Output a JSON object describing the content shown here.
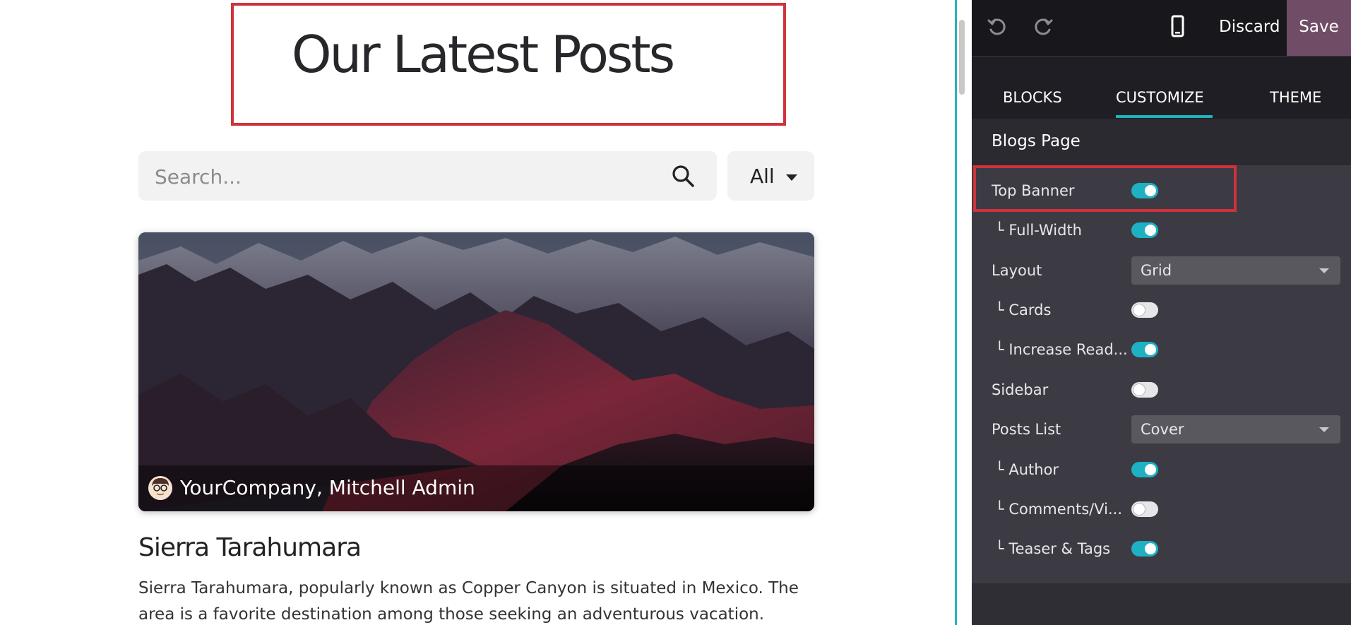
{
  "preview": {
    "title": "Our Latest Posts",
    "search": {
      "placeholder": "Search...",
      "icon": "search-icon"
    },
    "filter": {
      "label": "All",
      "icon": "caret-down-icon"
    },
    "post": {
      "authors": "YourCompany, Mitchell Admin",
      "title": "Sierra Tarahumara",
      "teaser_line1": "Sierra Tarahumara, popularly known as Copper Canyon is situated in Mexico. The",
      "teaser_line2": "area is a favorite destination among those seeking an adventurous vacation."
    }
  },
  "editor": {
    "toolbar": {
      "undo_icon": "undo-icon",
      "redo_icon": "redo-icon",
      "mobile_icon": "mobile-preview-icon",
      "discard": "Discard",
      "save": "Save"
    },
    "tabs": [
      {
        "label": "BLOCKS",
        "active": false
      },
      {
        "label": "CUSTOMIZE",
        "active": true
      },
      {
        "label": "THEME",
        "active": false
      }
    ],
    "section_title": "Blogs Page",
    "options": [
      {
        "label": "Top Banner",
        "sub": false,
        "type": "toggle",
        "on": true
      },
      {
        "label": "Full-Width",
        "sub": true,
        "type": "toggle",
        "on": true
      },
      {
        "label": "Layout",
        "sub": false,
        "type": "select",
        "value": "Grid"
      },
      {
        "label": "Cards",
        "sub": true,
        "type": "toggle",
        "on": false
      },
      {
        "label": "Increase Read...",
        "sub": true,
        "type": "toggle",
        "on": true
      },
      {
        "label": "Sidebar",
        "sub": false,
        "type": "toggle",
        "on": false
      },
      {
        "label": "Posts List",
        "sub": false,
        "type": "select",
        "value": "Cover"
      },
      {
        "label": "Author",
        "sub": true,
        "type": "toggle",
        "on": true
      },
      {
        "label": "Comments/Vi...",
        "sub": true,
        "type": "toggle",
        "on": false
      },
      {
        "label": "Teaser & Tags",
        "sub": true,
        "type": "toggle",
        "on": true
      }
    ],
    "sub_prefix": "└",
    "colors": {
      "accent": "#1eb1c3",
      "save": "#704c66",
      "highlight": "#d0323b"
    }
  }
}
